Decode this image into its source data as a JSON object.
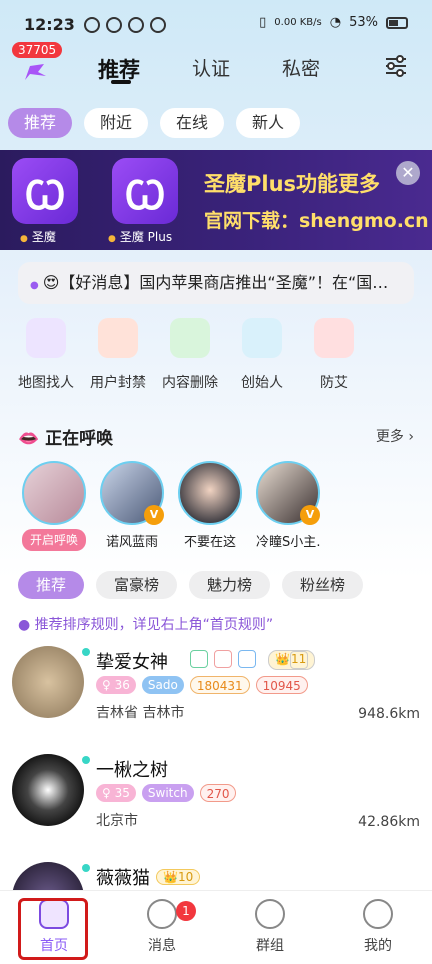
{
  "status": {
    "time": "12:23",
    "net": "0.00 KB/s",
    "battery": "53%"
  },
  "header": {
    "badge": "37705",
    "tabs": [
      {
        "label": "推荐"
      },
      {
        "label": "认证"
      },
      {
        "label": "私密"
      }
    ]
  },
  "filter_chips": [
    {
      "label": "推荐"
    },
    {
      "label": "附近"
    },
    {
      "label": "在线"
    },
    {
      "label": "新人"
    }
  ],
  "banner": {
    "app1": "圣魔",
    "app2": "圣魔 Plus",
    "title": "圣魔Plus功能更多",
    "url": "官网下载：shengmo.cn"
  },
  "news": "😍【好消息】国内苹果商店推出“圣魔”！在“国…",
  "features": [
    {
      "label": "地图找人",
      "icon": "map-pin-icon",
      "color": "#7f5bf0"
    },
    {
      "label": "用户封禁",
      "icon": "siren-icon",
      "color": "#f0603a"
    },
    {
      "label": "内容删除",
      "icon": "trash-icon",
      "color": "#3cc14a"
    },
    {
      "label": "创始人",
      "icon": "crown-icon",
      "color": "#3ab6e8"
    },
    {
      "label": "防艾",
      "icon": "ribbon-heart-icon",
      "color": "#f0464a"
    }
  ],
  "calling": {
    "title": "正在呼唤",
    "more": "更多",
    "start_button": "开启呼唤",
    "users": [
      {
        "name": "诺风蓝雨"
      },
      {
        "name": "不要在这"
      },
      {
        "name": "冷瞳S小主…"
      }
    ]
  },
  "rank_chips": [
    {
      "label": "推荐"
    },
    {
      "label": "富豪榜"
    },
    {
      "label": "魅力榜"
    },
    {
      "label": "粉丝榜"
    }
  ],
  "hint": "推荐排序规则，详见右上角“首页规则”",
  "users": [
    {
      "name": "挚爱女神",
      "level": "11",
      "tags": [
        "36",
        "Sado",
        "180431",
        "10945"
      ],
      "location": "吉林省 吉林市",
      "distance": "948.6km"
    },
    {
      "name": "一楸之树",
      "tags": [
        "35",
        "Switch",
        "270"
      ],
      "location": "北京市",
      "distance": "42.86km"
    },
    {
      "name": "薇薇猫",
      "level": "10"
    }
  ],
  "bottom_nav": {
    "items": [
      {
        "label": "首页"
      },
      {
        "label": "消息"
      },
      {
        "label": "群组"
      },
      {
        "label": "我的"
      }
    ],
    "msg_badge": "1"
  }
}
